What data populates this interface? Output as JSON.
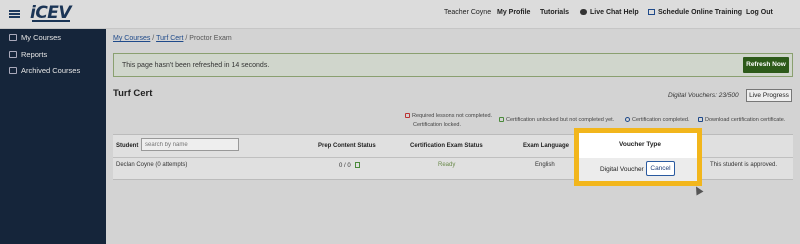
{
  "topbar": {
    "logo": "iCEV",
    "user_name": "Teacher Coyne",
    "my_profile": "My Profile",
    "tutorials": "Tutorials",
    "live_chat": "Live Chat Help",
    "schedule": "Schedule Online Training",
    "logout": "Log Out"
  },
  "sidebar": {
    "items": [
      {
        "label": "My Courses",
        "icon": "home-icon"
      },
      {
        "label": "Reports",
        "icon": "report-icon"
      },
      {
        "label": "Archived Courses",
        "icon": "archive-icon"
      }
    ]
  },
  "breadcrumb": {
    "my_courses": "My Courses",
    "sep1": "/",
    "turf_cert": "Turf Cert",
    "sep2": "/",
    "current": "Proctor Exam"
  },
  "banner": {
    "text": "This page hasn't been refreshed in 14 seconds.",
    "refresh_label": "Refresh Now"
  },
  "page_title": "Turf Cert",
  "vouchers_text": "Digital Vouchers: 23/500",
  "live_progress_label": "Live Progress",
  "legend": {
    "required": "Required lessons not completed.",
    "locked": "Certification locked.",
    "unlocked": "Certification unlocked but not completed yet.",
    "completed": "Certification completed.",
    "download": "Download certification certificate."
  },
  "table": {
    "headers": {
      "student": "Student",
      "prep_status": "Prep Content Status",
      "exam_status": "Certification Exam Status",
      "exam_language": "Exam Language",
      "voucher_type": "Voucher Type"
    },
    "search_placeholder": "search by name",
    "row": {
      "student": "Declan Coyne (0 attempts)",
      "prep_score": "0 / 0",
      "exam_status": "Ready",
      "language": "English",
      "voucher_type": "Digital Voucher",
      "cancel_label": "Cancel",
      "approval": "This student is approved."
    }
  },
  "colors": {
    "sidebar_bg": "#15253a",
    "refresh_btn": "#2d5a1a",
    "highlight": "#f2b61c",
    "link": "#1f4a8a"
  }
}
